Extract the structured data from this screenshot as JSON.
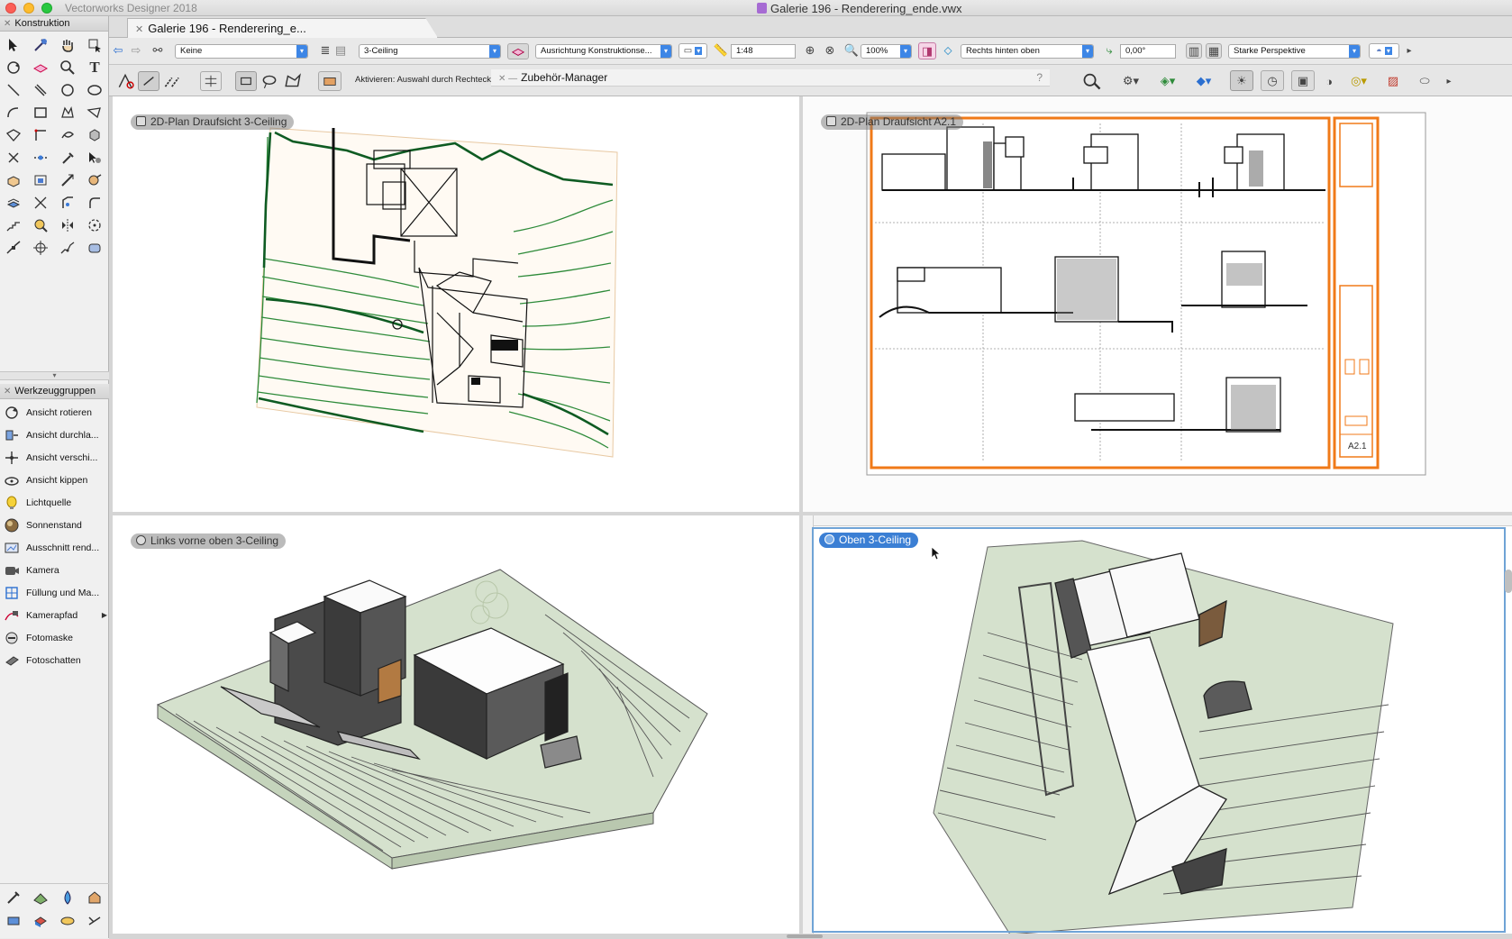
{
  "window": {
    "app_name": "Vectorworks Designer 2018",
    "document_title": "Galerie 196 - Renderering_ende.vwx"
  },
  "tab": {
    "label": "Galerie 196 - Renderering_e..."
  },
  "toolbar1": {
    "class_value": "Keine",
    "layer_value": "3-Ceiling",
    "working_plane": "Ausrichtung Konstruktionse...",
    "scale": "1:48",
    "zoom": "100%",
    "view": "Rechts hinten oben",
    "rotation": "0,00°",
    "projection": "Starke Perspektive"
  },
  "toolbar2": {
    "mode_hint": "Aktivieren: Auswahl durch Rechteck",
    "manager_title": "Zubehör-Manager",
    "manager_help": "?"
  },
  "palettes": {
    "konstruktion_title": "Konstruktion",
    "werkzeuggruppen_title": "Werkzeuggruppen",
    "werkzeuggruppen_items": [
      {
        "label": "Ansicht rotieren",
        "icon": "rotate-view-icon"
      },
      {
        "label": "Ansicht durchla...",
        "icon": "walkthrough-icon"
      },
      {
        "label": "Ansicht verschi...",
        "icon": "pan-view-icon"
      },
      {
        "label": "Ansicht kippen",
        "icon": "tilt-view-icon"
      },
      {
        "label": "Lichtquelle",
        "icon": "light-source-icon"
      },
      {
        "label": "Sonnenstand",
        "icon": "sun-position-icon"
      },
      {
        "label": "Ausschnitt rend...",
        "icon": "render-crop-icon"
      },
      {
        "label": "Kamera",
        "icon": "camera-icon"
      },
      {
        "label": "Füllung und Ma...",
        "icon": "fill-material-icon"
      },
      {
        "label": "Kamerapfad",
        "icon": "camera-path-icon",
        "submenu": true
      },
      {
        "label": "Fotomaske",
        "icon": "photo-mask-icon"
      },
      {
        "label": "Fotoschatten",
        "icon": "photo-shadow-icon"
      }
    ]
  },
  "viewports": {
    "top_left": {
      "label": "2D-Plan Draufsicht  3-Ceiling"
    },
    "top_right": {
      "label": "2D-Plan Draufsicht  A2.1",
      "sheet_number": "A2.1"
    },
    "bottom_left": {
      "label": "Links vorne oben  3-Ceiling"
    },
    "bottom_right": {
      "label": "Oben  3-Ceiling",
      "active": true
    }
  },
  "colors": {
    "accent": "#3b7fd4",
    "contour_green": "#2e8b3a",
    "sheet_orange": "#f07a18",
    "terrain_fill": "#d5e1cd"
  }
}
